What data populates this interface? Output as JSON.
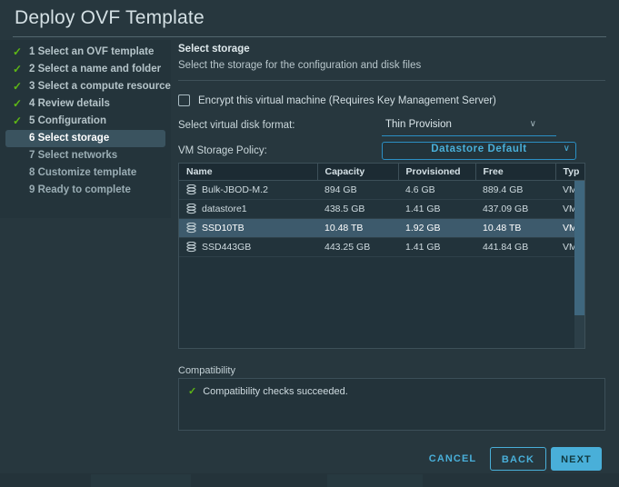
{
  "window": {
    "title": "Deploy OVF Template",
    "accent_color": "#49afd9",
    "background_color": "#27373e",
    "success_color": "#5eb715"
  },
  "sidebar": {
    "steps": [
      {
        "label": "1 Select an OVF template",
        "state": "done",
        "check": "✓"
      },
      {
        "label": "2 Select a name and folder",
        "state": "done",
        "check": "✓"
      },
      {
        "label": "3 Select a compute resource",
        "state": "done",
        "check": "✓"
      },
      {
        "label": "4 Review details",
        "state": "done",
        "check": "✓"
      },
      {
        "label": "5 Configuration",
        "state": "done",
        "check": "✓"
      },
      {
        "label": "6 Select storage",
        "state": "active",
        "check": ""
      },
      {
        "label": "7 Select networks",
        "state": "pending",
        "check": ""
      },
      {
        "label": "8 Customize template",
        "state": "pending",
        "check": ""
      },
      {
        "label": "9 Ready to complete",
        "state": "pending",
        "check": ""
      }
    ]
  },
  "main": {
    "section_title": "Select storage",
    "section_subtitle": "Select the storage for the configuration and disk files",
    "encrypt": {
      "label": "Encrypt this virtual machine (Requires Key Management Server)",
      "checked": false
    },
    "disk_format": {
      "label": "Select virtual disk format:",
      "value": "Thin Provision",
      "caret": "∨"
    },
    "storage_policy": {
      "label": "VM Storage Policy:",
      "value": "Datastore Default",
      "caret": "∨"
    },
    "table": {
      "columns": [
        "Name",
        "Capacity",
        "Provisioned",
        "Free",
        "Typ"
      ],
      "rows": [
        {
          "name": "Bulk-JBOD-M.2",
          "capacity": "894 GB",
          "provisioned": "4.6 GB",
          "free": "889.4 GB",
          "type": "VM",
          "selected": false
        },
        {
          "name": "datastore1",
          "capacity": "438.5 GB",
          "provisioned": "1.41 GB",
          "free": "437.09 GB",
          "type": "VM",
          "selected": false
        },
        {
          "name": "SSD10TB",
          "capacity": "10.48 TB",
          "provisioned": "1.92 GB",
          "free": "10.48 TB",
          "type": "VM",
          "selected": true
        },
        {
          "name": "SSD443GB",
          "capacity": "443.25 GB",
          "provisioned": "1.41 GB",
          "free": "441.84 GB",
          "type": "VM",
          "selected": false
        }
      ]
    },
    "compatibility": {
      "label": "Compatibility",
      "message": "Compatibility checks succeeded.",
      "check": "✓"
    }
  },
  "footer": {
    "cancel_label": "CANCEL",
    "back_label": "BACK",
    "next_label": "NEXT"
  }
}
